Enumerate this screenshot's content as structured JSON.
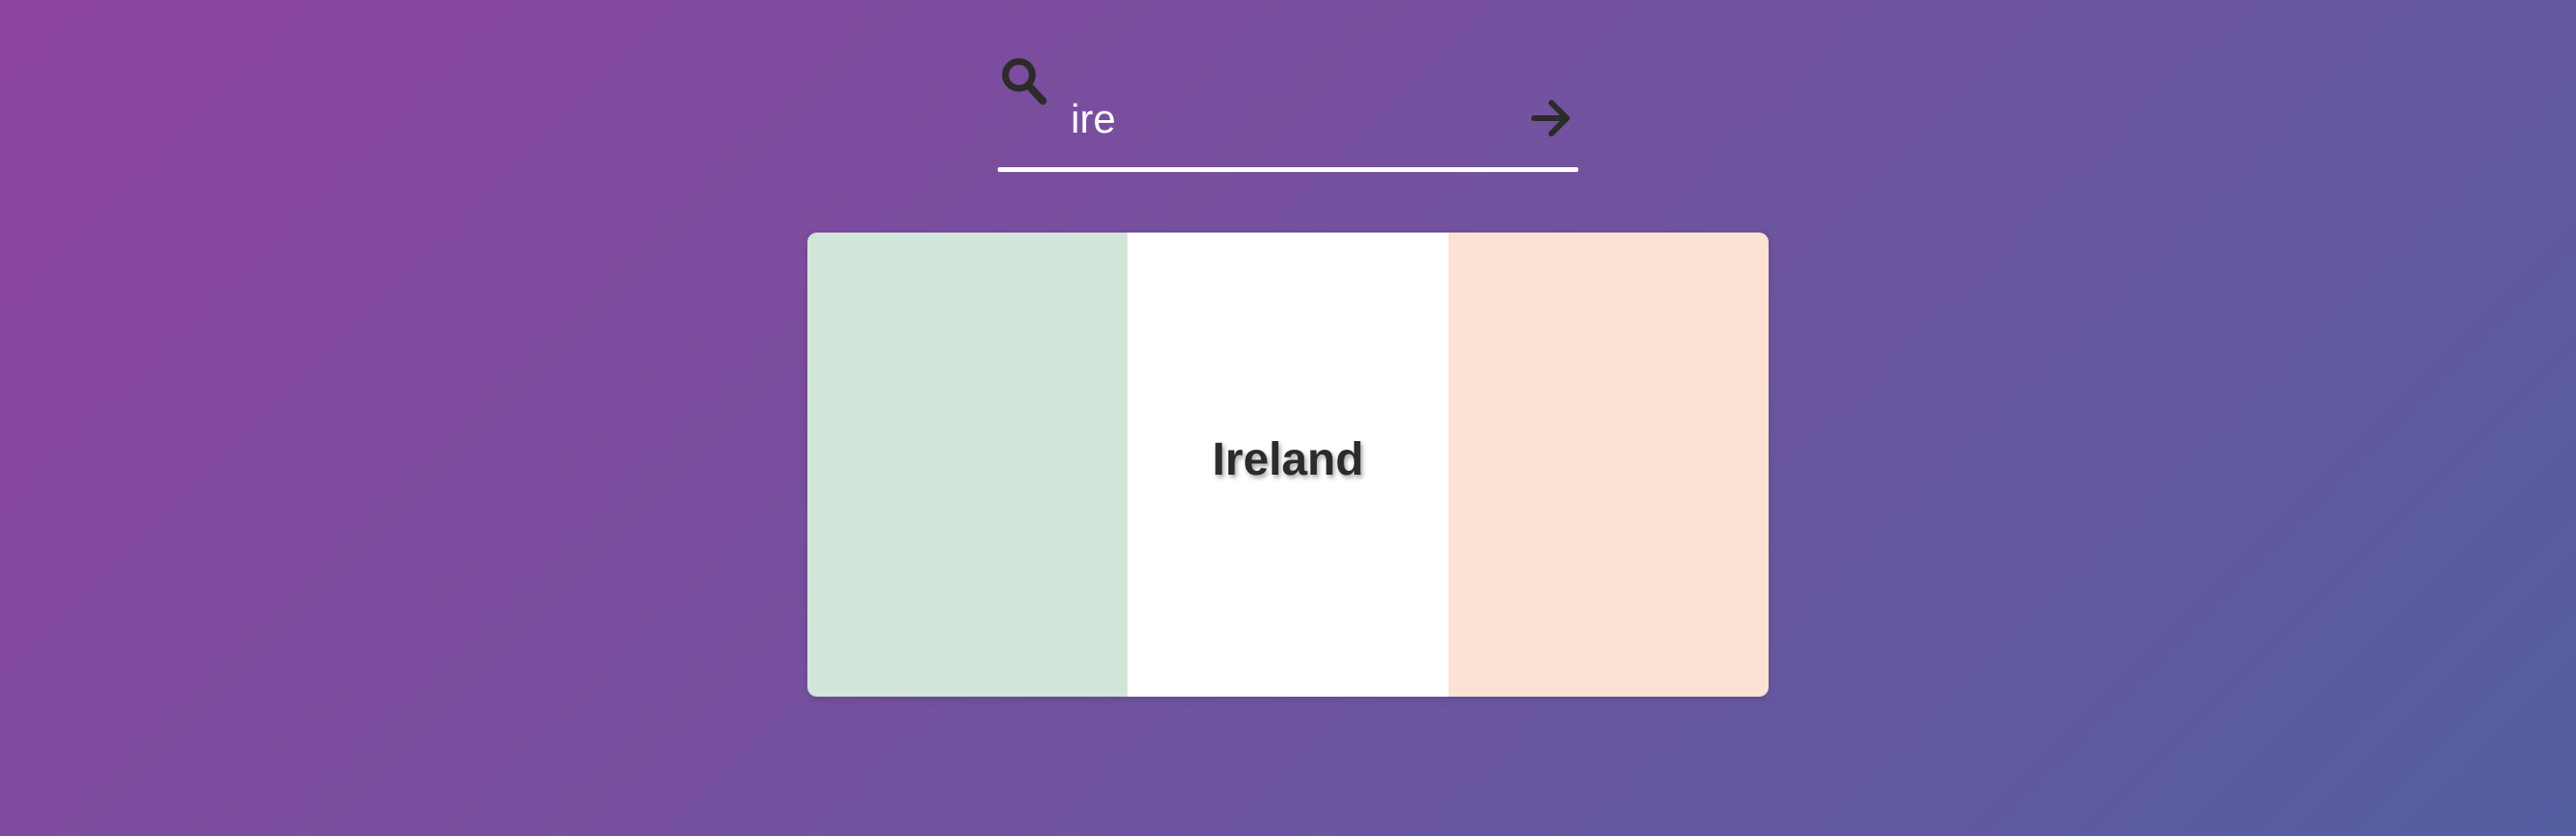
{
  "search": {
    "value": "ire",
    "placeholder": "",
    "icon": "search-icon",
    "submit_icon": "arrow-right-icon"
  },
  "result": {
    "country": "Ireland",
    "flag_colors": [
      "#d1e5d8",
      "#ffffff",
      "#fbe2d3"
    ]
  },
  "colors": {
    "background_start": "#8e44a0",
    "background_end": "#545fa0",
    "icon": "#2b2b2b",
    "text": "#ffffff"
  }
}
